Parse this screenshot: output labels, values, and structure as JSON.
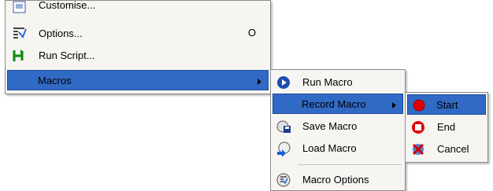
{
  "menu1": {
    "items": [
      {
        "label": "Customise..."
      },
      {
        "label": "Options...",
        "shortcut": "O"
      },
      {
        "label": "Run Script..."
      },
      {
        "label": "Macros"
      }
    ]
  },
  "menu2": {
    "items": [
      {
        "label": "Run Macro",
        "icon": "play-icon"
      },
      {
        "label": "Record Macro"
      },
      {
        "label": "Save Macro",
        "icon": "save-icon"
      },
      {
        "label": "Load Macro",
        "icon": "load-icon"
      },
      {
        "label": "Macro Options",
        "icon": "macro-options-icon"
      }
    ]
  },
  "menu3": {
    "items": [
      {
        "label": "Start",
        "icon": "record-icon"
      },
      {
        "label": "End",
        "icon": "stop-icon"
      },
      {
        "label": "Cancel",
        "icon": "cancel-icon"
      }
    ]
  },
  "colors": {
    "highlight": "#316ac5",
    "menu_bg": "#f6f5f2"
  }
}
